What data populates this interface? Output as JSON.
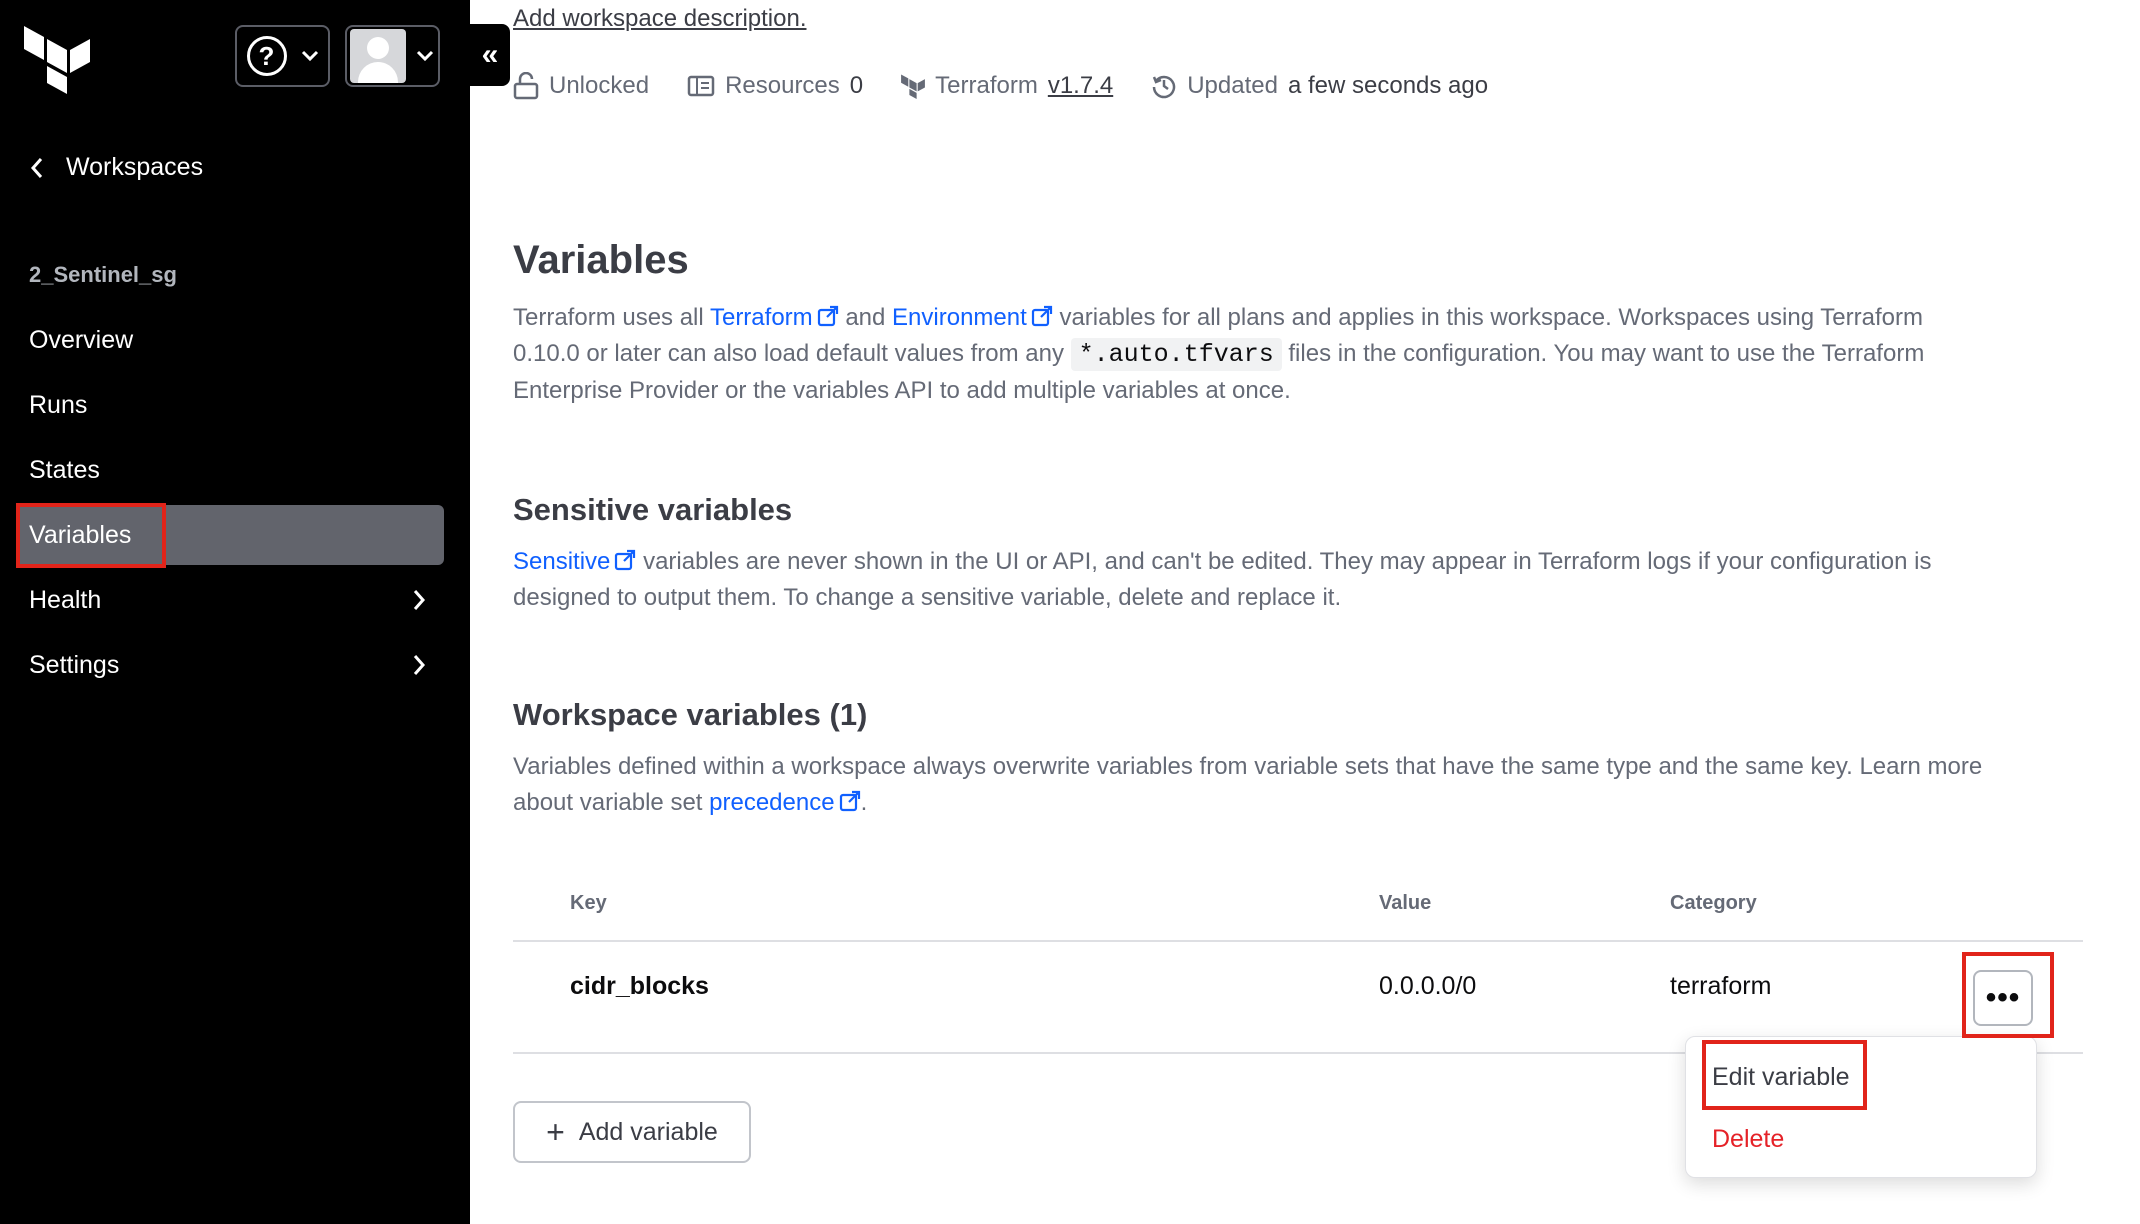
{
  "sidebar": {
    "back_label": "Workspaces",
    "workspace_name": "2_Sentinel_sg",
    "nav": [
      {
        "label": "Overview"
      },
      {
        "label": "Runs"
      },
      {
        "label": "States"
      },
      {
        "label": "Variables",
        "active": true
      },
      {
        "label": "Health",
        "has_children": true
      },
      {
        "label": "Settings",
        "has_children": true
      }
    ]
  },
  "header": {
    "description_link": "Add workspace description.",
    "lock_label": "Unlocked",
    "resources_label": "Resources",
    "resources_count": "0",
    "terraform_label": "Terraform",
    "terraform_version": "v1.7.4",
    "updated_label": "Updated",
    "updated_value": "a few seconds ago"
  },
  "variables": {
    "title": "Variables",
    "intro_1": "Terraform uses all",
    "link_terraform": "Terraform",
    "intro_and": "and",
    "link_environment": "Environment",
    "intro_2": "variables for all plans and applies in this workspace. Workspaces using Terraform",
    "intro_3": "0.10.0 or later can also load default values from any",
    "code_tfvars": "*.auto.tfvars",
    "intro_4": "files in the configuration. You may want to use the Terraform",
    "intro_5": "Enterprise Provider or the variables API to add multiple variables at once."
  },
  "sensitive": {
    "title": "Sensitive variables",
    "link_sensitive": "Sensitive",
    "text_1": "variables are never shown in the UI or API, and can't be edited. They may appear in Terraform logs if your configuration is",
    "text_2": "designed to output them. To change a sensitive variable, delete and replace it."
  },
  "workspace_vars": {
    "title": "Workspace variables (1)",
    "text_1": "Variables defined within a workspace always overwrite variables from variable sets that have the same type and the same key. Learn more",
    "text_2": "about variable set",
    "link_precedence": "precedence",
    "text_end": ".",
    "columns": [
      "Key",
      "Value",
      "Category"
    ],
    "rows": [
      {
        "key": "cidr_blocks",
        "value": "0.0.0.0/0",
        "category": "terraform"
      }
    ],
    "add_button": "Add variable",
    "menu": {
      "edit": "Edit variable",
      "delete": "Delete"
    }
  },
  "colors": {
    "sidebar_bg": "#000000",
    "active_nav": "#62646c",
    "link": "#1060ff",
    "danger": "#e52228",
    "highlight_box": "#e1241a"
  }
}
